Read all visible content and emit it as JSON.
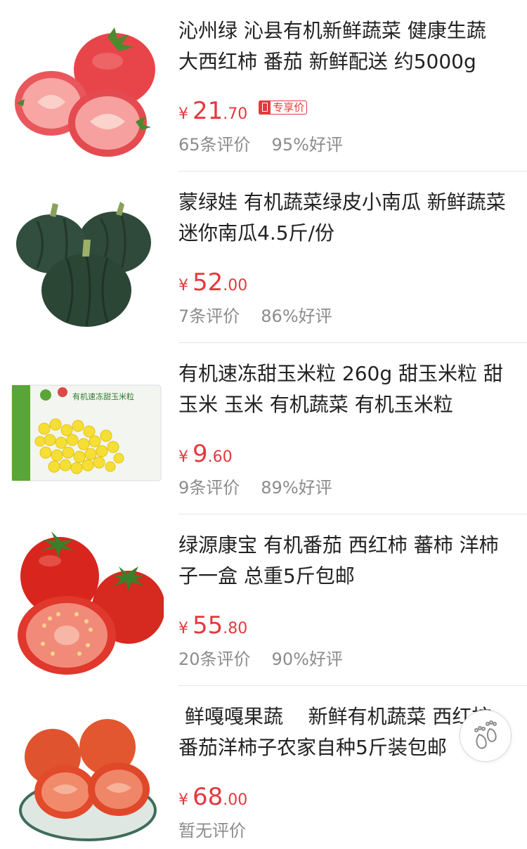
{
  "currency_symbol": "¥",
  "products": [
    {
      "title": "沁州绿 沁县有机新鲜蔬菜 健康生蔬 大西红柿 番茄 新鲜配送 约5000g",
      "price_int": "21",
      "price_dec": ".70",
      "badge": "专享价",
      "reviews": "65条评价",
      "rating": "95%好评",
      "image": "tomato-halves-icon"
    },
    {
      "title": "蒙绿娃 有机蔬菜绿皮小南瓜 新鲜蔬菜迷你南瓜4.5斤/份",
      "price_int": "52",
      "price_dec": ".00",
      "reviews": "7条评价",
      "rating": "86%好评",
      "image": "pumpkin-icon"
    },
    {
      "title": "有机速冻甜玉米粒 260g 甜玉米粒 甜玉米 玉米 有机蔬菜 有机玉米粒",
      "price_int": "9",
      "price_dec": ".60",
      "reviews": "9条评价",
      "rating": "89%好评",
      "image": "corn-bag-icon",
      "package_text": "有机速冻甜玉米粒"
    },
    {
      "title": "绿源康宝 有机番茄 西红柿 蕃柿 洋柿子一盒 总重5斤包邮",
      "price_int": "55",
      "price_dec": ".80",
      "reviews": "20条评价",
      "rating": "90%好评",
      "image": "tomatoes-icon"
    },
    {
      "title": " 鲜嘎嘎果蔬    新鲜有机蔬菜 西红柿番茄洋柿子农家自种5斤装包邮",
      "price_int": "68",
      "price_dec": ".00",
      "reviews": "暂无评价",
      "rating": "",
      "image": "tomato-plate-icon"
    }
  ],
  "footprint_button": "footprint-icon"
}
